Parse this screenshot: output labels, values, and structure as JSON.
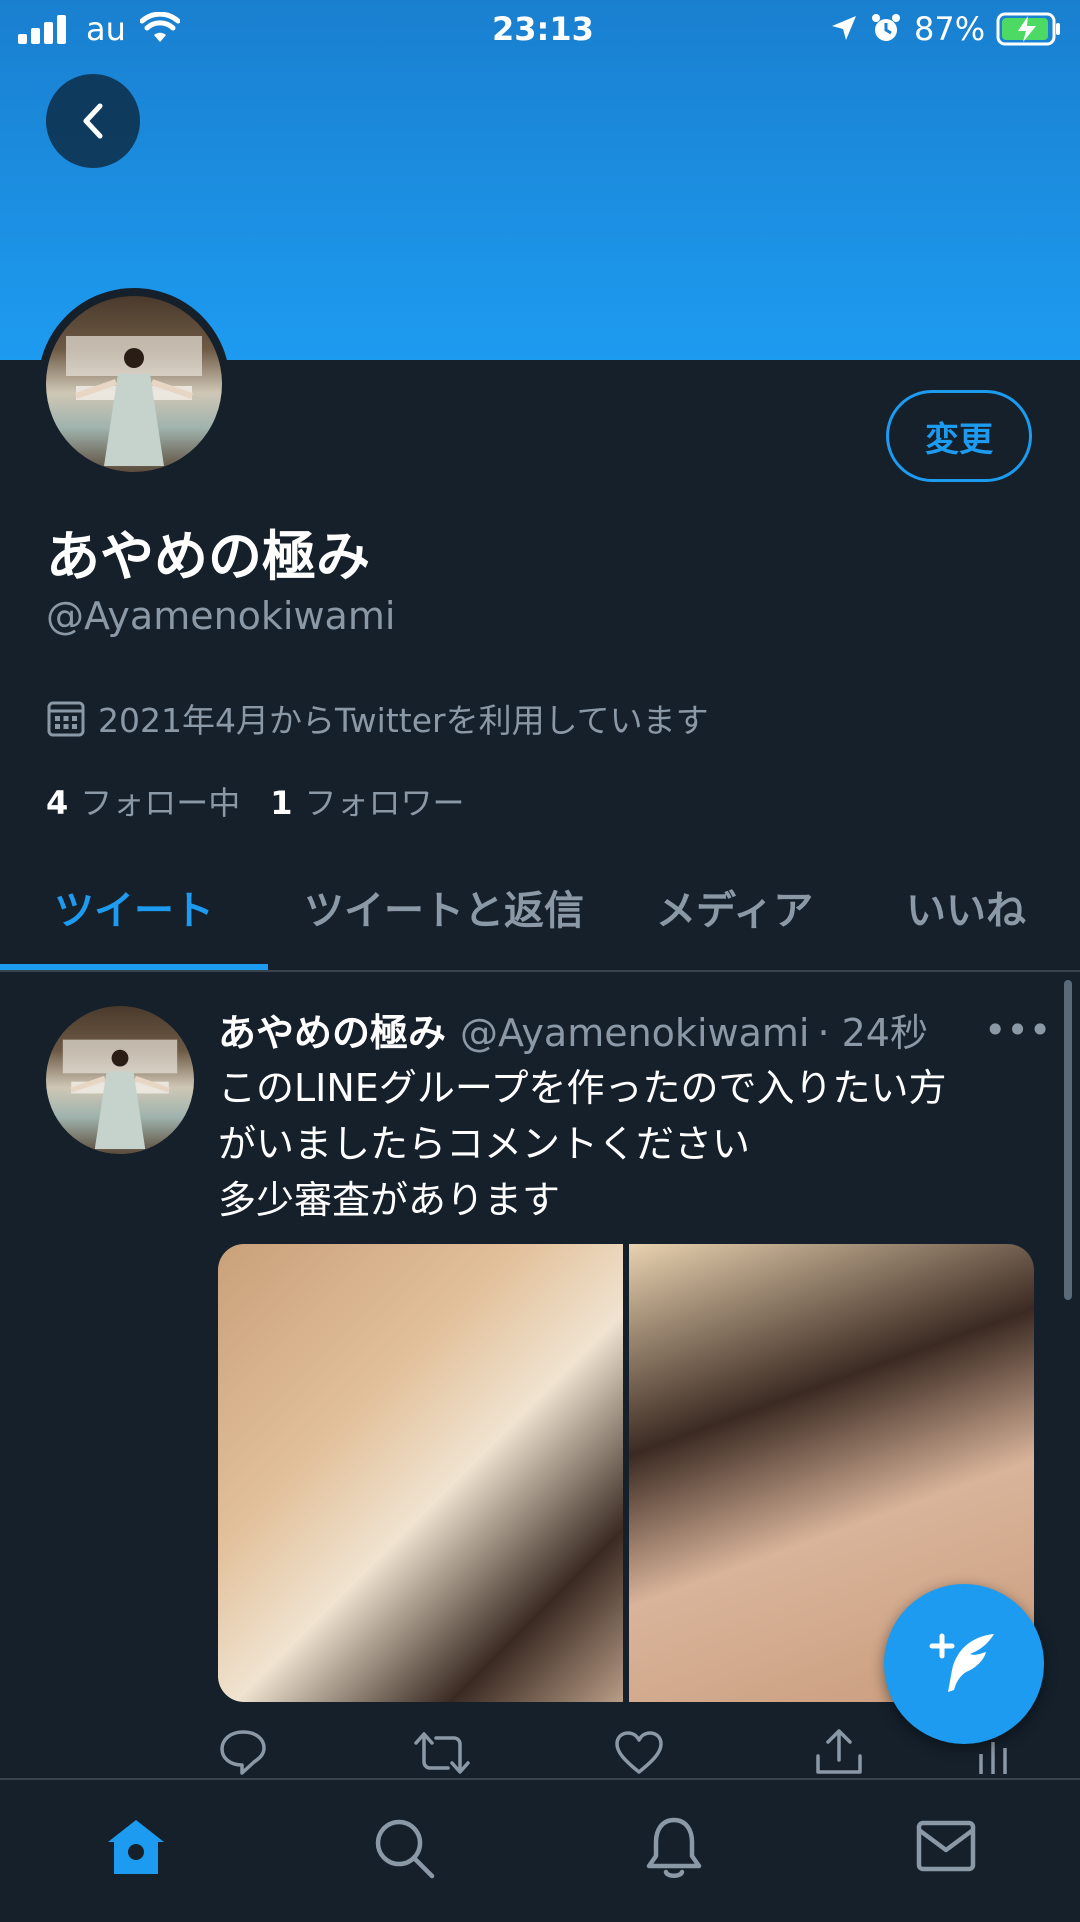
{
  "status_bar": {
    "carrier": "au",
    "time": "23:13",
    "battery": "87%"
  },
  "profile": {
    "edit_label": "変更",
    "name": "あやめの極み",
    "handle": "@Ayamenokiwami",
    "joined": "2021年4月からTwitterを利用しています",
    "following_count": "4",
    "following_label": "フォロー中",
    "followers_count": "1",
    "followers_label": "フォロワー"
  },
  "tabs": [
    {
      "label": "ツイート",
      "active": true
    },
    {
      "label": "ツイートと返信",
      "active": false
    },
    {
      "label": "メディア",
      "active": false
    },
    {
      "label": "いいね",
      "active": false
    }
  ],
  "tweet": {
    "author": "あやめの極み",
    "handle": "@Ayamenokiwami",
    "time": "· 24秒",
    "text": "このLINEグループを作ったので入りたい方\nがいましたらコメントください\n多少審査があります",
    "more": "•••"
  },
  "colors": {
    "accent": "#1d9bf0",
    "background": "#15202b",
    "muted": "#8b98a5",
    "border": "#38444d"
  },
  "icons": {
    "nav": [
      "home-icon",
      "search-icon",
      "bell-icon",
      "mail-icon"
    ],
    "actions": [
      "reply-icon",
      "retweet-icon",
      "like-icon",
      "share-icon",
      "analytics-icon"
    ]
  }
}
